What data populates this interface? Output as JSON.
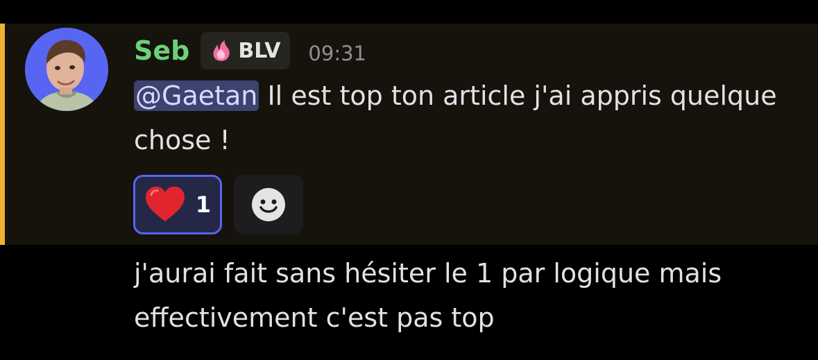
{
  "message": {
    "author": "Seb",
    "author_color": "#6dcf7b",
    "tag": {
      "label": "BLV",
      "icon": "pink-flame-icon"
    },
    "timestamp": "09:31",
    "mention": "@Gaetan",
    "text": " Il est top ton article j'ai appris quelque chose !",
    "reactions": [
      {
        "emoji": "red-heart-icon",
        "count": "1",
        "selected": true
      }
    ],
    "add_reaction_icon": "smiley-face-icon",
    "mention_highlight_color": "#f0b232"
  },
  "next_message": {
    "text": "j'aurai fait sans hésiter le 1 par logique mais effectivement c'est pas top"
  }
}
